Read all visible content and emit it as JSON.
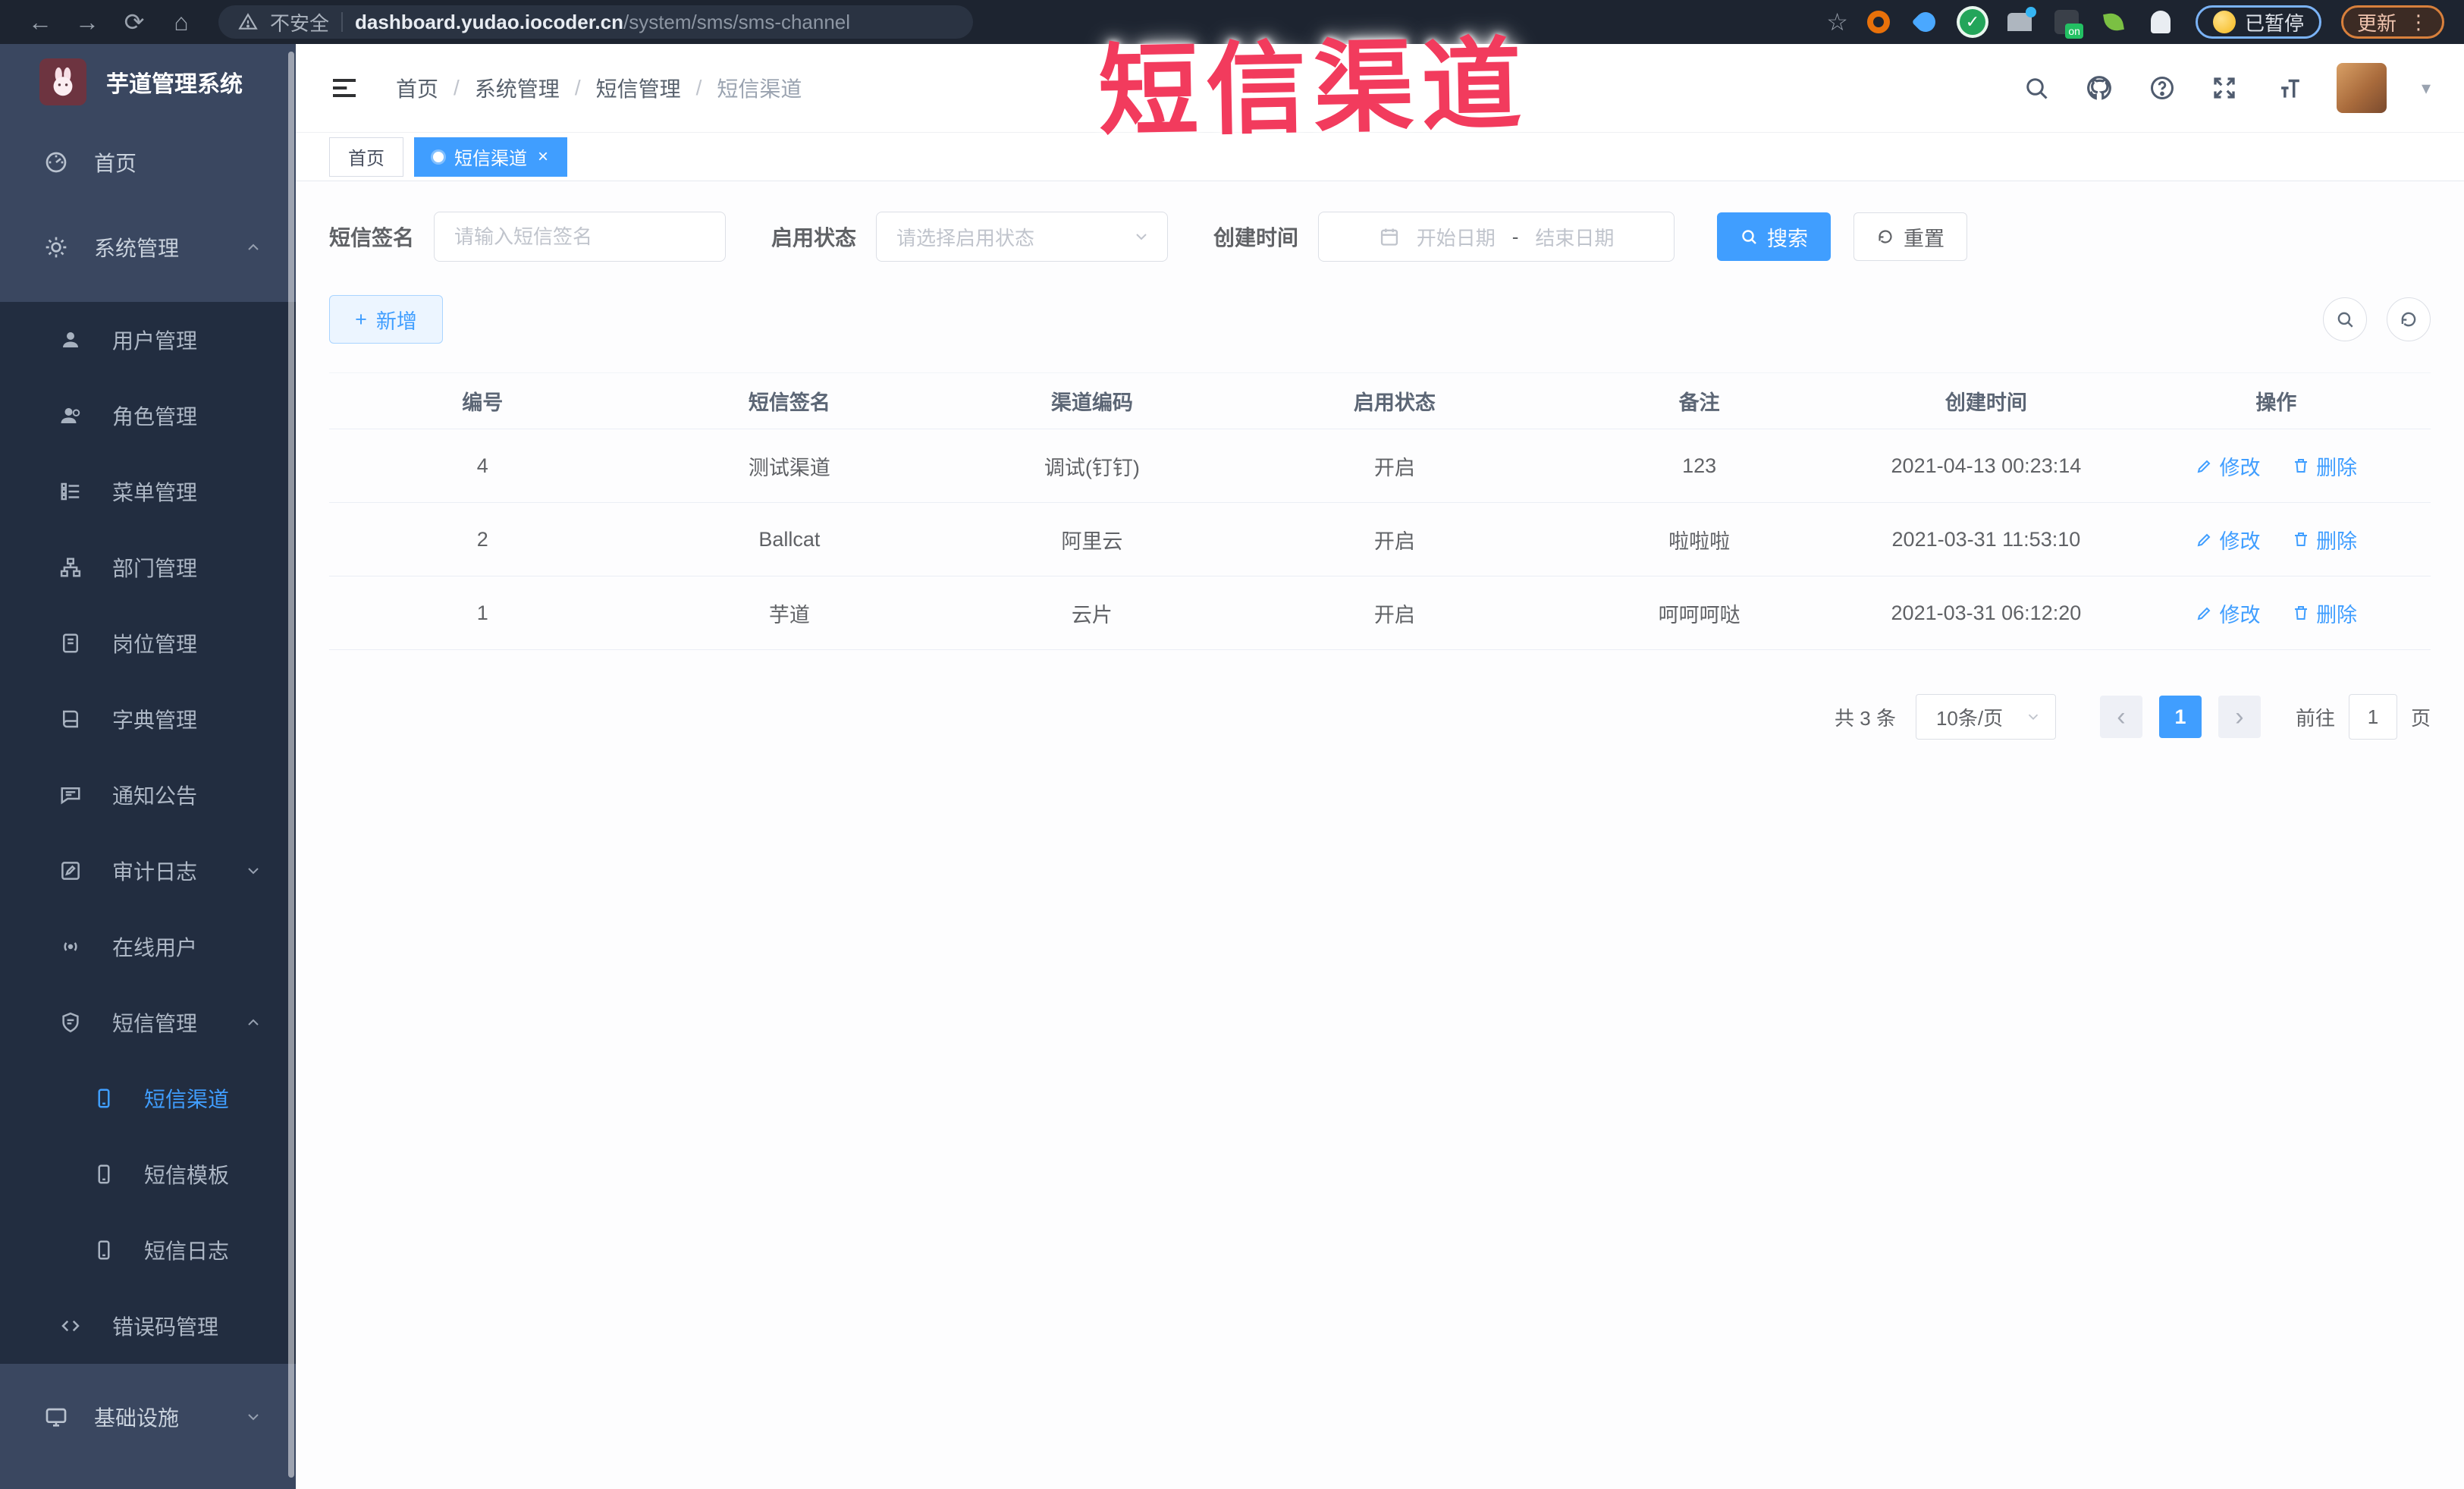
{
  "colors": {
    "accent": "#409eff",
    "annotation_red": "#f23b5d",
    "sidebar_light": "#3a4760",
    "sidebar_dark": "#222d40",
    "active_tab": "#409eff"
  },
  "icons": {
    "back": "←",
    "forward": "→",
    "reload": "⟳",
    "home": "⌂",
    "star": "☆",
    "close": "×",
    "prev": "‹",
    "next": "›",
    "caret": "▾",
    "plus": "+",
    "dots": "⋮",
    "check": "✓"
  },
  "annotation": {
    "text": "短信渠道"
  },
  "browser": {
    "security_label": "不安全",
    "url_host": "dashboard.yudao.iocoder.cn",
    "url_path": "/system/sms/sms-channel",
    "paused_label": "已暂停",
    "update_label": "更新"
  },
  "sidebar": {
    "title": "芋道管理系统",
    "items": [
      {
        "label": "首页"
      },
      {
        "label": "系统管理"
      },
      {
        "label": "用户管理"
      },
      {
        "label": "角色管理"
      },
      {
        "label": "菜单管理"
      },
      {
        "label": "部门管理"
      },
      {
        "label": "岗位管理"
      },
      {
        "label": "字典管理"
      },
      {
        "label": "通知公告"
      },
      {
        "label": "审计日志"
      },
      {
        "label": "在线用户"
      },
      {
        "label": "短信管理"
      },
      {
        "label": "短信渠道"
      },
      {
        "label": "短信模板"
      },
      {
        "label": "短信日志"
      },
      {
        "label": "错误码管理"
      },
      {
        "label": "基础设施"
      }
    ]
  },
  "header": {
    "breadcrumb": [
      "首页",
      "系统管理",
      "短信管理",
      "短信渠道"
    ]
  },
  "tabs": [
    {
      "label": "首页"
    },
    {
      "label": "短信渠道"
    }
  ],
  "filters": {
    "sign_label": "短信签名",
    "sign_placeholder": "请输入短信签名",
    "status_label": "启用状态",
    "status_placeholder": "请选择启用状态",
    "time_label": "创建时间",
    "start_placeholder": "开始日期",
    "range_sep": "-",
    "end_placeholder": "结束日期",
    "search_label": "搜索",
    "reset_label": "重置"
  },
  "toolbar": {
    "add_label": "新增"
  },
  "table": {
    "headers": [
      "编号",
      "短信签名",
      "渠道编码",
      "启用状态",
      "备注",
      "创建时间",
      "操作"
    ],
    "edit_label": "修改",
    "delete_label": "删除",
    "rows": [
      {
        "id": "4",
        "sign": "测试渠道",
        "code": "调试(钉钉)",
        "status": "开启",
        "remark": "123",
        "created": "2021-04-13 00:23:14"
      },
      {
        "id": "2",
        "sign": "Ballcat",
        "code": "阿里云",
        "status": "开启",
        "remark": "啦啦啦",
        "created": "2021-03-31 11:53:10"
      },
      {
        "id": "1",
        "sign": "芋道",
        "code": "云片",
        "status": "开启",
        "remark": "呵呵呵哒",
        "created": "2021-03-31 06:12:20"
      }
    ]
  },
  "pagination": {
    "total": "共 3 条",
    "page_size": "10条/页",
    "current": "1",
    "goto_label": "前往",
    "goto_value": "1",
    "page_label": "页"
  }
}
